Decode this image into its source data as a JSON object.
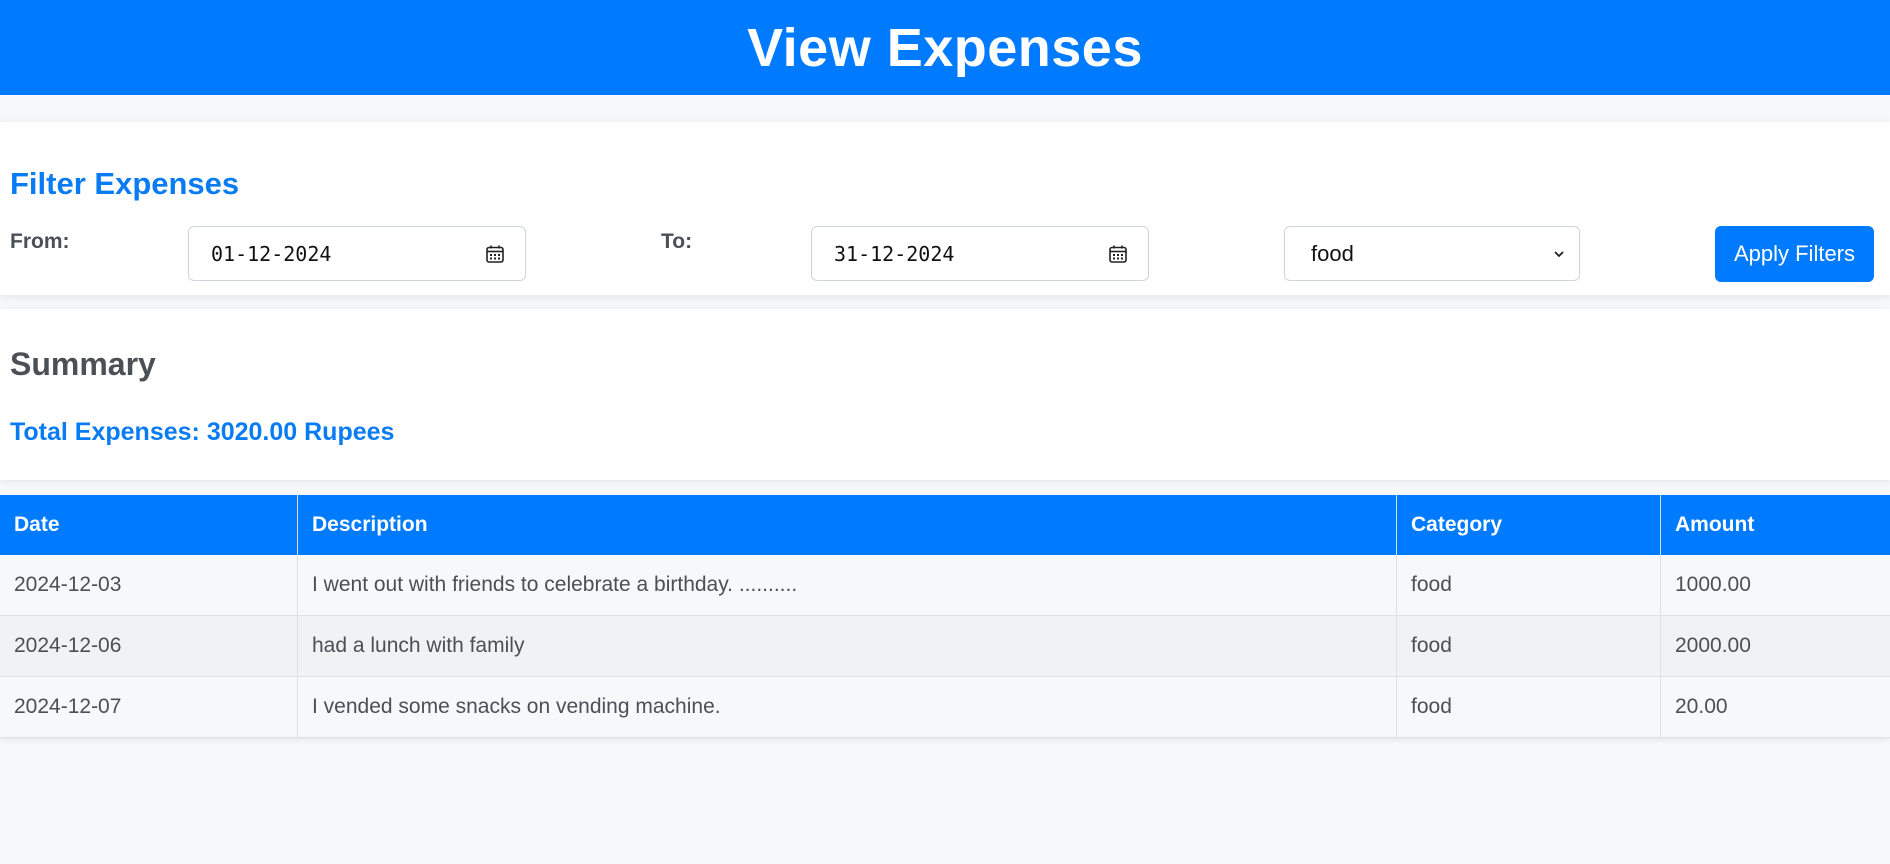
{
  "header": {
    "title": "View Expenses"
  },
  "filters": {
    "title": "Filter Expenses",
    "from_label": "From:",
    "from_value": "01-12-2024",
    "to_label": "To:",
    "to_value": "31-12-2024",
    "category_selected": "food",
    "apply_label": "Apply Filters"
  },
  "summary": {
    "title": "Summary",
    "total_text": "Total Expenses: 3020.00 Rupees"
  },
  "table": {
    "headers": [
      "Date",
      "Description",
      "Category",
      "Amount"
    ],
    "rows": [
      {
        "date": "2024-12-03",
        "description": "I went out with friends to celebrate a birthday. ..........",
        "category": "food",
        "amount": "1000.00"
      },
      {
        "date": "2024-12-06",
        "description": "had a lunch with family",
        "category": "food",
        "amount": "2000.00"
      },
      {
        "date": "2024-12-07",
        "description": "I vended some snacks on vending machine.",
        "category": "food",
        "amount": "20.00"
      }
    ]
  },
  "colors": {
    "accent": "#007bff",
    "background": "#f6f8fa",
    "text": "#4b4f56"
  },
  "icons": {
    "date_picker": "calendar-icon",
    "select": "chevron-down-icon"
  }
}
